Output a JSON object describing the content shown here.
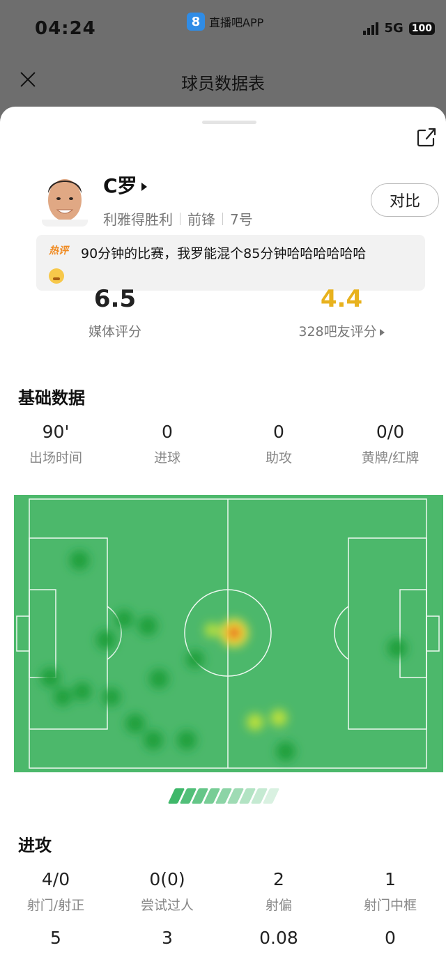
{
  "status_bar": {
    "time": "04:24",
    "app_name": "直播吧APP",
    "app_logo": "8",
    "network": "5G",
    "battery": "100"
  },
  "header": {
    "title": "球员数据表"
  },
  "player": {
    "name": "C罗",
    "team": "利雅得胜利",
    "position": "前锋",
    "number": "7号",
    "compare_label": "对比"
  },
  "hot_comment": {
    "tag": "热评",
    "text": "90分钟的比赛，我罗能混个85分钟哈哈哈哈哈哈"
  },
  "ratings": {
    "media": {
      "value": "6.5",
      "label": "媒体评分"
    },
    "fans": {
      "value": "4.4",
      "label": "328吧友评分"
    }
  },
  "basic_stats": {
    "title": "基础数据",
    "items": [
      {
        "value": "90'",
        "label": "出场时间"
      },
      {
        "value": "0",
        "label": "进球"
      },
      {
        "value": "0",
        "label": "助攻"
      },
      {
        "value": "0/0",
        "label": "黄牌/红牌"
      }
    ]
  },
  "attack_stats": {
    "title": "进攻",
    "items": [
      {
        "value": "4/0",
        "label": "射门/射正"
      },
      {
        "value": "0(0)",
        "label": "尝试过人"
      },
      {
        "value": "2",
        "label": "射偏"
      },
      {
        "value": "1",
        "label": "射门中框"
      }
    ],
    "row2": [
      {
        "value": "5"
      },
      {
        "value": "3"
      },
      {
        "value": "0.08"
      },
      {
        "value": "0"
      }
    ]
  },
  "colors": {
    "pitch": "#4cb86b",
    "accent": "#e8b21e",
    "chevron": "#3fb86a"
  }
}
